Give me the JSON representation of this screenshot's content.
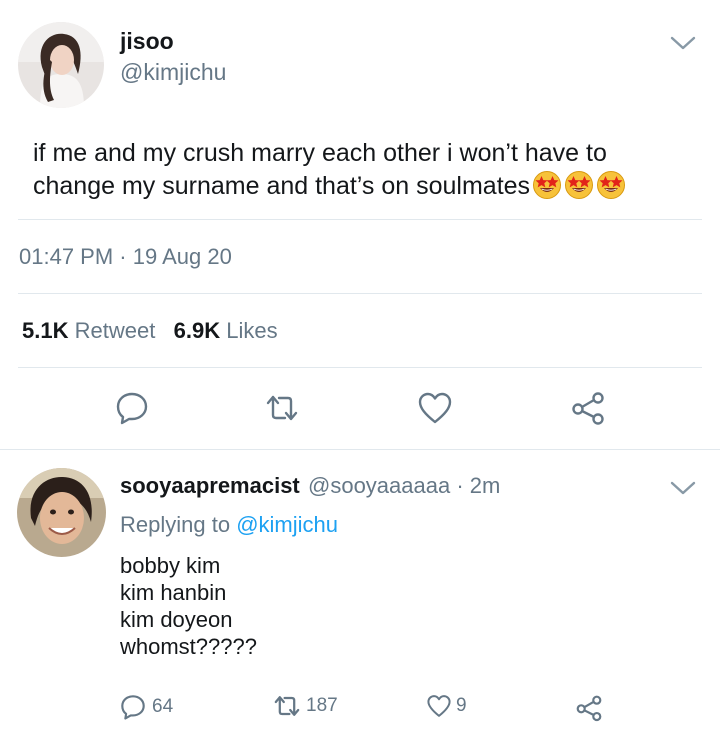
{
  "tweet": {
    "name": "jisoo",
    "handle": "@kimjichu",
    "text": "if me and my crush marry each other i won’t have to change my surname and that’s on soulmates",
    "emoji_count": 3,
    "timestamp": "01:47 PM · 19 Aug 20",
    "retweet_count": "5.1K",
    "retweet_label": "Retweet",
    "like_count": "6.9K",
    "like_label": "Likes",
    "icons": [
      "reply-icon",
      "retweet-icon",
      "heart-icon",
      "share-icon"
    ]
  },
  "reply": {
    "name": "sooyaapremacist",
    "meta": "@sooyaaaaaa · 2m",
    "replying_prefix": "Replying to",
    "replying_handle": "@kimjichu",
    "lines": [
      "bobby kim",
      "kim hanbin",
      "kim doyeon",
      "whomst?????"
    ],
    "reply_count": "64",
    "retweet_count": "187",
    "like_count": "9"
  },
  "colors": {
    "text": "#14171a",
    "secondary": "#657786",
    "link": "#1da1f2",
    "divider": "#e1e8ed"
  }
}
